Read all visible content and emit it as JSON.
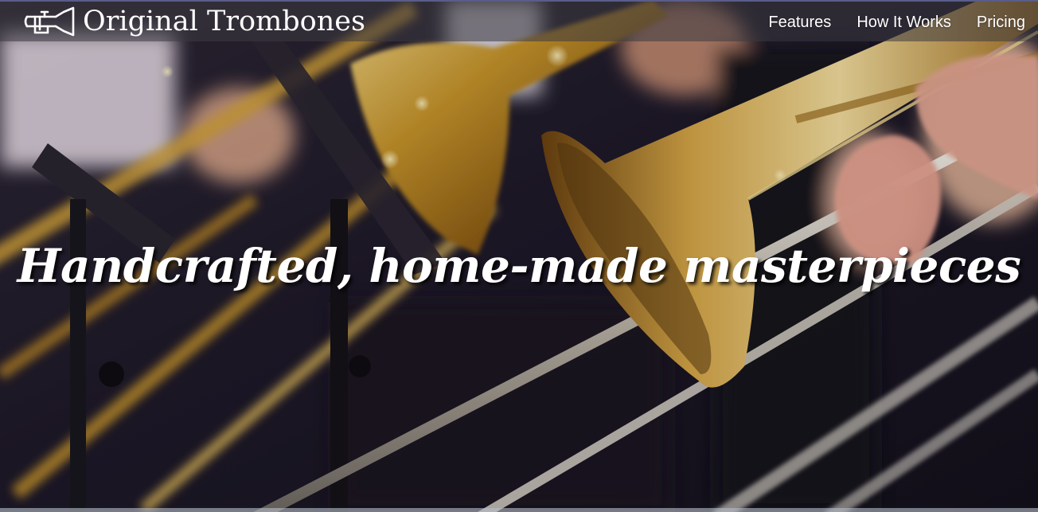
{
  "brand": {
    "name": "Original Trombones",
    "logo_icon": "trombone-icon"
  },
  "nav": {
    "items": [
      {
        "label": "Features"
      },
      {
        "label": "How It Works"
      },
      {
        "label": "Pricing"
      }
    ]
  },
  "hero": {
    "headline": "Handcrafted, home-made masterpieces",
    "background_image": "trombone-section-photo"
  },
  "colors": {
    "header_bg": "#3c3a42",
    "header_border": "#5a5d8a",
    "text": "#ffffff",
    "brass": "#c89a30"
  }
}
